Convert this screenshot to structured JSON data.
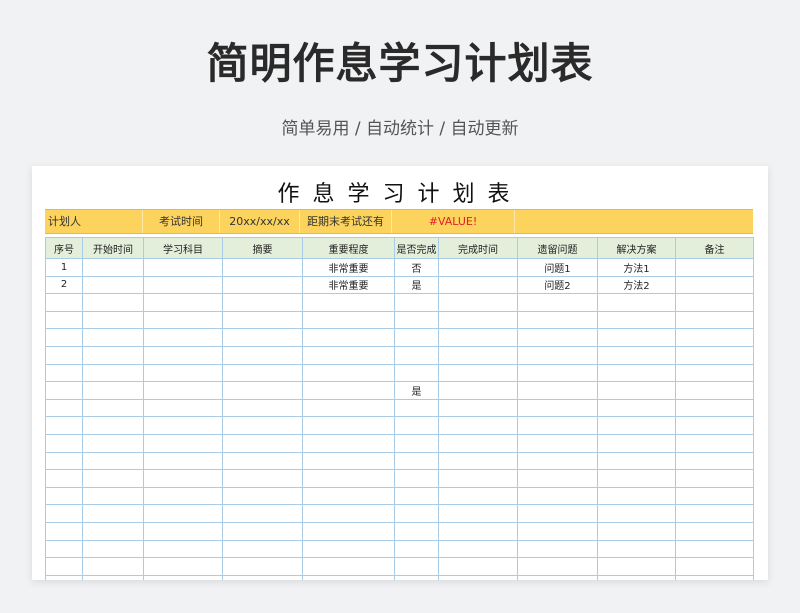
{
  "page": {
    "title": "简明作息学习计划表",
    "subtitle": "简单易用 / 自动统计 / 自动更新"
  },
  "sheet": {
    "title": "作息学习计划表",
    "info": {
      "planner_label": "计划人",
      "exam_time_label": "考试时间",
      "exam_time_value": "20xx/xx/xx",
      "remaining_label": "距期末考试还有",
      "remaining_value": "#VALUE!"
    },
    "headers": [
      "序号",
      "开始时间",
      "学习科目",
      "摘要",
      "重要程度",
      "是否完成",
      "完成时间",
      "遗留问题",
      "解决方案",
      "备注"
    ],
    "rows": [
      {
        "no": "1",
        "start": "",
        "subject": "",
        "summary": "",
        "importance": "非常重要",
        "done": "否",
        "done_time": "",
        "issue": "问题1",
        "solution": "方法1",
        "note": ""
      },
      {
        "no": "2",
        "start": "",
        "subject": "",
        "summary": "",
        "importance": "非常重要",
        "done": "是",
        "done_time": "",
        "issue": "问题2",
        "solution": "方法2",
        "note": ""
      },
      {
        "no": "",
        "start": "",
        "subject": "",
        "summary": "",
        "importance": "",
        "done": "",
        "done_time": "",
        "issue": "",
        "solution": "",
        "note": ""
      },
      {
        "no": "",
        "start": "",
        "subject": "",
        "summary": "",
        "importance": "",
        "done": "",
        "done_time": "",
        "issue": "",
        "solution": "",
        "note": ""
      },
      {
        "no": "",
        "start": "",
        "subject": "",
        "summary": "",
        "importance": "",
        "done": "",
        "done_time": "",
        "issue": "",
        "solution": "",
        "note": ""
      },
      {
        "no": "",
        "start": "",
        "subject": "",
        "summary": "",
        "importance": "",
        "done": "",
        "done_time": "",
        "issue": "",
        "solution": "",
        "note": ""
      },
      {
        "no": "",
        "start": "",
        "subject": "",
        "summary": "",
        "importance": "",
        "done": "",
        "done_time": "",
        "issue": "",
        "solution": "",
        "note": ""
      },
      {
        "no": "",
        "start": "",
        "subject": "",
        "summary": "",
        "importance": "",
        "done": "是",
        "done_time": "",
        "issue": "",
        "solution": "",
        "note": ""
      },
      {
        "no": "",
        "start": "",
        "subject": "",
        "summary": "",
        "importance": "",
        "done": "",
        "done_time": "",
        "issue": "",
        "solution": "",
        "note": ""
      },
      {
        "no": "",
        "start": "",
        "subject": "",
        "summary": "",
        "importance": "",
        "done": "",
        "done_time": "",
        "issue": "",
        "solution": "",
        "note": ""
      },
      {
        "no": "",
        "start": "",
        "subject": "",
        "summary": "",
        "importance": "",
        "done": "",
        "done_time": "",
        "issue": "",
        "solution": "",
        "note": ""
      },
      {
        "no": "",
        "start": "",
        "subject": "",
        "summary": "",
        "importance": "",
        "done": "",
        "done_time": "",
        "issue": "",
        "solution": "",
        "note": ""
      },
      {
        "no": "",
        "start": "",
        "subject": "",
        "summary": "",
        "importance": "",
        "done": "",
        "done_time": "",
        "issue": "",
        "solution": "",
        "note": ""
      },
      {
        "no": "",
        "start": "",
        "subject": "",
        "summary": "",
        "importance": "",
        "done": "",
        "done_time": "",
        "issue": "",
        "solution": "",
        "note": ""
      },
      {
        "no": "",
        "start": "",
        "subject": "",
        "summary": "",
        "importance": "",
        "done": "",
        "done_time": "",
        "issue": "",
        "solution": "",
        "note": ""
      },
      {
        "no": "",
        "start": "",
        "subject": "",
        "summary": "",
        "importance": "",
        "done": "",
        "done_time": "",
        "issue": "",
        "solution": "",
        "note": ""
      },
      {
        "no": "",
        "start": "",
        "subject": "",
        "summary": "",
        "importance": "",
        "done": "",
        "done_time": "",
        "issue": "",
        "solution": "",
        "note": ""
      },
      {
        "no": "",
        "start": "",
        "subject": "",
        "summary": "",
        "importance": "",
        "done": "",
        "done_time": "",
        "issue": "",
        "solution": "",
        "note": ""
      },
      {
        "no": "",
        "start": "",
        "subject": "",
        "summary": "",
        "importance": "",
        "done": "",
        "done_time": "",
        "issue": "",
        "solution": "",
        "note": ""
      }
    ]
  },
  "colors": {
    "info_bar": "#fcd35d",
    "header_row": "#e3efdb",
    "grid_line": "#a8cbe8",
    "done_text": "#2fae5a",
    "error_text": "#e02020"
  }
}
